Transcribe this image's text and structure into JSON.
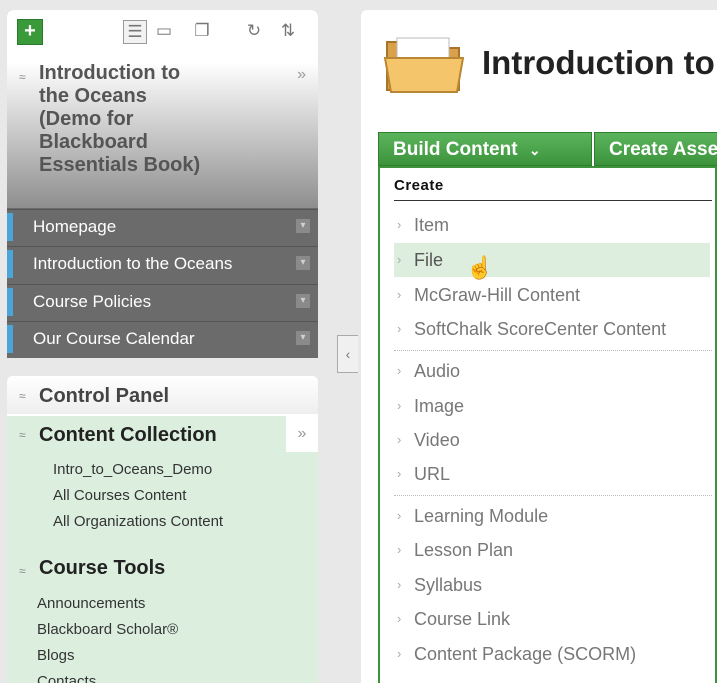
{
  "sidebar": {
    "toolbar": {
      "add_label": "+",
      "icons": [
        "list-view-icon",
        "folder-view-icon",
        "window-icon",
        "refresh-icon",
        "sort-icon"
      ]
    },
    "course": {
      "title": "Introduction to the Oceans (Demo for Blackboard Essentials Book)",
      "title_lines": [
        "Introduction to",
        "the Oceans",
        "(Demo for",
        "Blackboard",
        "Essentials Book)"
      ]
    },
    "nav_items": [
      {
        "label": "Homepage"
      },
      {
        "label": "Introduction to the Oceans"
      },
      {
        "label": "Course Policies"
      },
      {
        "label": "Our Course Calendar"
      }
    ],
    "control_panel": {
      "title": "Control Panel",
      "content_collection": {
        "title": "Content Collection",
        "links": [
          "Intro_to_Oceans_Demo",
          "All Courses Content",
          "All Organizations Content"
        ]
      },
      "course_tools": {
        "title": "Course Tools",
        "links": [
          "Announcements",
          "Blackboard Scholar®",
          "Blogs",
          "Contacts"
        ]
      }
    }
  },
  "main": {
    "page_title": "Introduction to",
    "buttons": {
      "build_content": "Build Content",
      "create_assessment": "Create Assessment"
    },
    "menu": {
      "section_title": "Create",
      "groups": [
        [
          "Item",
          "File",
          "McGraw-Hill Content",
          "SoftChalk ScoreCenter Content"
        ],
        [
          "Audio",
          "Image",
          "Video",
          "URL"
        ],
        [
          "Learning Module",
          "Lesson Plan",
          "Syllabus",
          "Course Link",
          "Content Package (SCORM)"
        ]
      ],
      "highlighted_item": "File"
    }
  },
  "colors": {
    "accent_green": "#3c933c",
    "nav_bar_blue": "#4ba5d8",
    "panel_green": "#dcefdf",
    "nav_gray": "#6b6b6b"
  }
}
